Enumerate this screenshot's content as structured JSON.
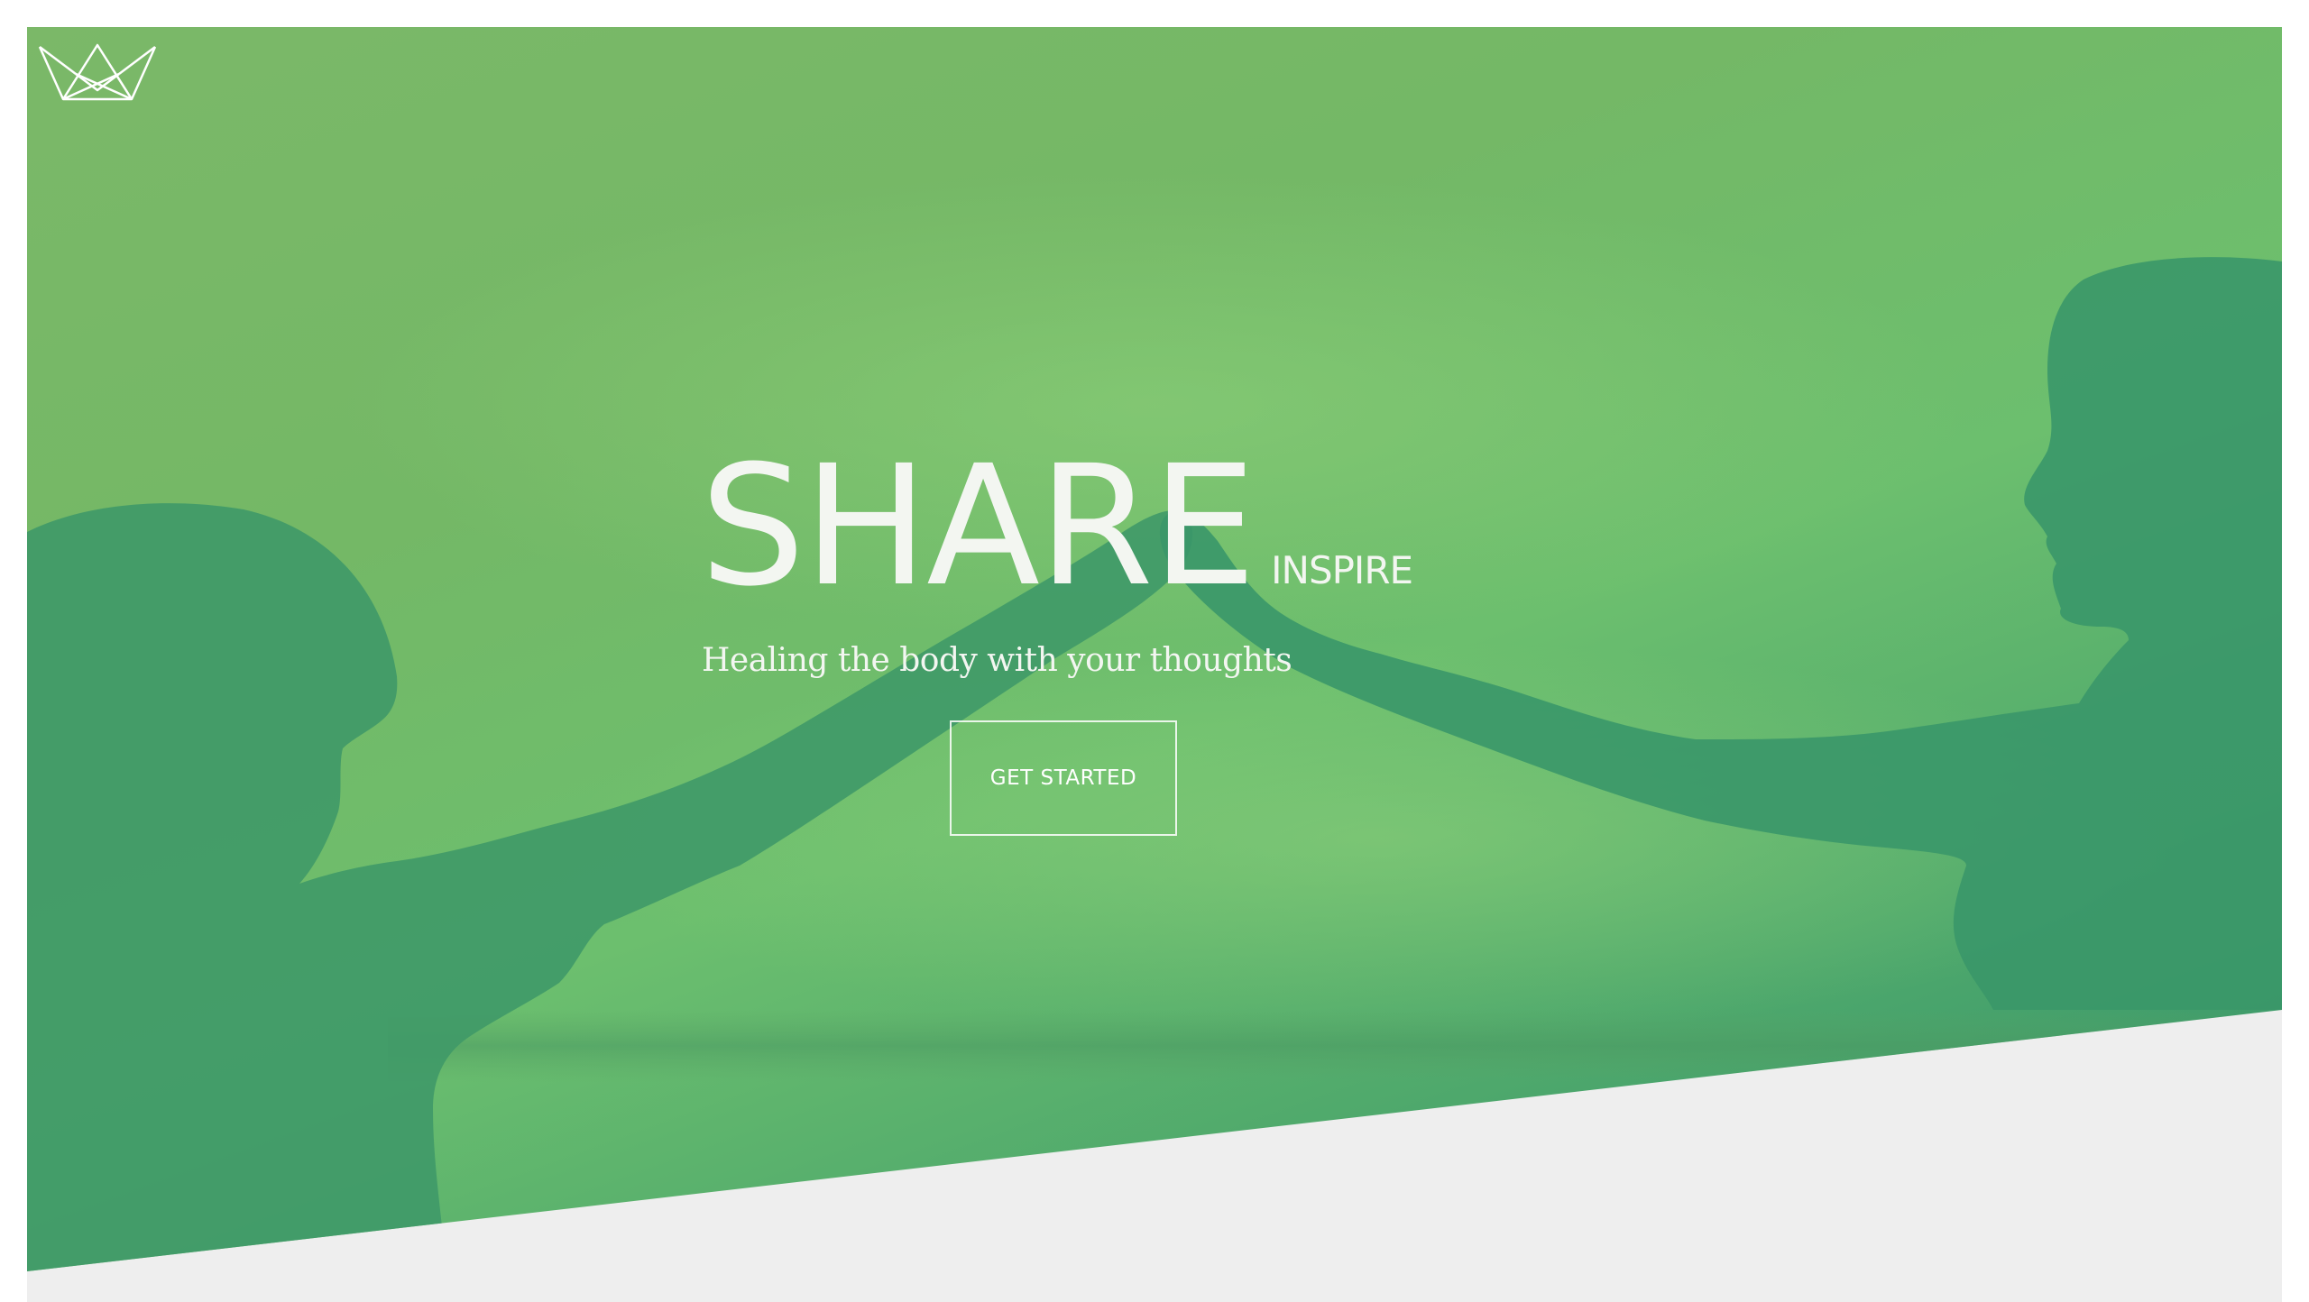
{
  "logo": {
    "icon": "crown-icon"
  },
  "hero": {
    "headline_big": "SHARE",
    "headline_small": "INSPIRE",
    "tagline": "Healing the body with your thoughts",
    "cta_label": "GET STARTED",
    "background_image": "silhouettes-heart-hands"
  },
  "colors": {
    "hero_green_light": "#7bb868",
    "hero_green_dark": "#2e8e6a",
    "silhouette": "#3f9968",
    "page_background": "#eeeeee",
    "text": "#f3f6f1"
  }
}
